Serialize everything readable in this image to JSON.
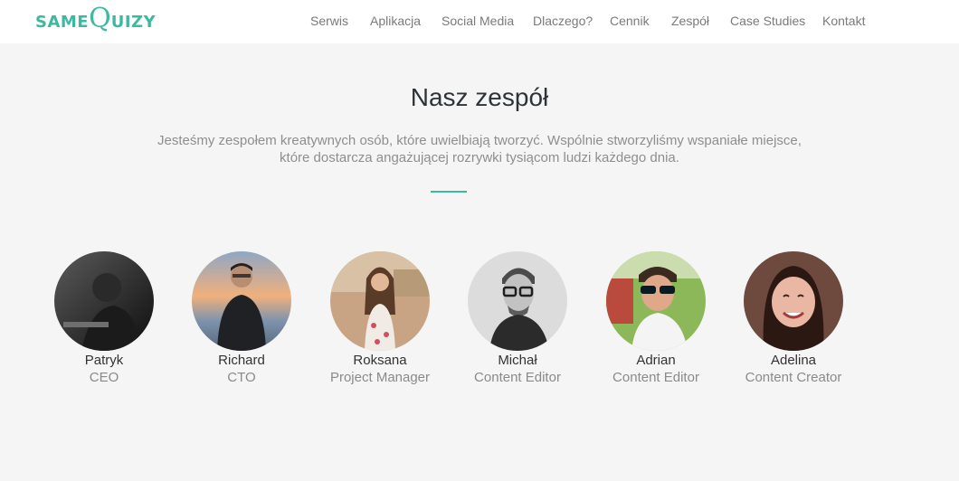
{
  "header": {
    "logo": {
      "part1": "SAME",
      "part2": "Q",
      "part3": "UIZY"
    },
    "nav": [
      "Serwis",
      "Aplikacja",
      "Social Media",
      "Dlaczego?",
      "Cennik",
      "Zespół",
      "Case Studies",
      "Kontakt"
    ]
  },
  "section": {
    "title": "Nasz zespół",
    "lead_line1": "Jesteśmy zespołem kreatywnych osób, które uwielbiają tworzyć. Wspólnie stworzyliśmy wspaniałe miejsce,",
    "lead_line2": "które dostarcza angażującej rozrywki tysiącom ludzi każdego dnia."
  },
  "team": [
    {
      "name": "Patryk",
      "role": "CEO"
    },
    {
      "name": "Richard",
      "role": "CTO"
    },
    {
      "name": "Roksana",
      "role": "Project Manager"
    },
    {
      "name": "Michał",
      "role": "Content Editor"
    },
    {
      "name": "Adrian",
      "role": "Content Editor"
    },
    {
      "name": "Adelina",
      "role": "Content Creator"
    }
  ],
  "colors": {
    "accent": "#3bb9a1",
    "background": "#f5f5f5",
    "header": "#ffffff"
  }
}
